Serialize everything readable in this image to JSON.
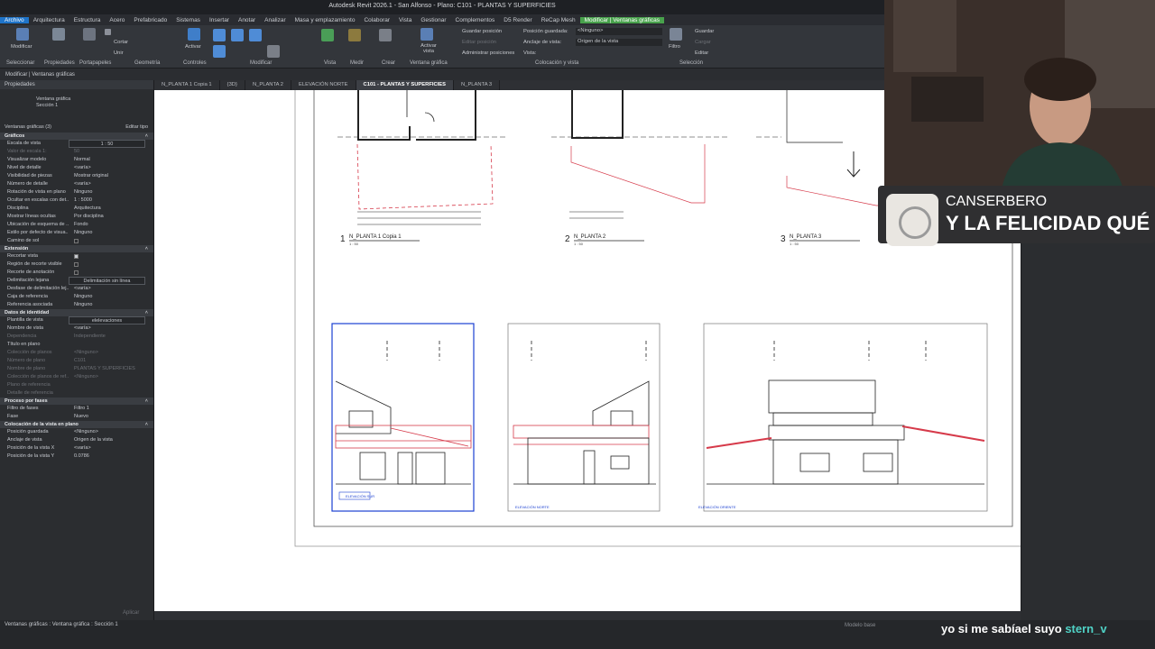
{
  "window": {
    "title": "Autodesk Revit 2026.1 - San Alfonso - Plano: C101 - PLANTAS Y SUPERFICIES"
  },
  "menu": [
    "Archivo",
    "Arquitectura",
    "Estructura",
    "Acero",
    "Prefabricado",
    "Sistemas",
    "Insertar",
    "Anotar",
    "Analizar",
    "Masa y emplazamiento",
    "Colaborar",
    "Vista",
    "Gestionar",
    "Complementos",
    "D5 Render",
    "ReCap Mesh",
    "Modificar | Ventanas gráficas"
  ],
  "ribbon": {
    "modify": "Modificar",
    "groups": [
      "Seleccionar",
      "Propiedades",
      "Portapapeles",
      "Geometría",
      "Controles",
      "Modificar",
      "Vista",
      "Medir",
      "Crear",
      "Ventana gráfica",
      "Colocación y vista",
      "Selección"
    ],
    "activate_view": "Activar vista",
    "save_position": "Guardar posición",
    "edit_position": "Editar posición",
    "manage_positions": "Administrar posiciones",
    "saved_position_label": "Posición guardada:",
    "saved_position_value": "<Ninguno>",
    "anchor_label": "Anclaje de vista:",
    "anchor_value": "Origen de la vista",
    "view_label": "Vista:",
    "filter": "Filtro",
    "save": "Guardar",
    "load": "Cargar",
    "edit": "Editar",
    "cortar": "Cortar",
    "unir": "Unir",
    "activar": "Activar"
  },
  "options_bar": "Modificar | Ventanas gráficas",
  "properties": {
    "header": "Propiedades",
    "type_line1": "Ventana gráfica",
    "type_line2": "Sección 1",
    "selector": "Ventanas gráficas (3)",
    "edit_type": "Editar tipo",
    "apply": "Aplicar",
    "sections": [
      {
        "title": "Gráficos",
        "rows": [
          {
            "k": "Escala de vista",
            "v": "1 : 50",
            "box": true
          },
          {
            "k": "Valor de escala 1:",
            "v": "50",
            "dim": true
          },
          {
            "k": "Visualizar modelo",
            "v": "Normal"
          },
          {
            "k": "Nivel de detalle",
            "v": "<varía>"
          },
          {
            "k": "Visibilidad de piezas",
            "v": "Mostrar original"
          },
          {
            "k": "Número de detalle",
            "v": "<varía>"
          },
          {
            "k": "Rotación de vista en plano",
            "v": "Ninguno"
          },
          {
            "k": "Ocultar en escalas con det...",
            "v": "1 : 5000"
          },
          {
            "k": "Disciplina",
            "v": "Arquitectura"
          },
          {
            "k": "Mostrar líneas ocultas",
            "v": "Por disciplina"
          },
          {
            "k": "Ubicación de esquema de ...",
            "v": "Fondo"
          },
          {
            "k": "Estilo por defecto de visua...",
            "v": "Ninguno"
          },
          {
            "k": "Camino de sol",
            "v": "",
            "check": false
          }
        ]
      },
      {
        "title": "Extensión",
        "rows": [
          {
            "k": "Recortar vista",
            "v": "",
            "check": true
          },
          {
            "k": "Región de recorte visible",
            "v": "",
            "check": false
          },
          {
            "k": "Recorte de anotación",
            "v": "",
            "check": false
          },
          {
            "k": "Delimitación lejana",
            "v": "Delimitación sin línea",
            "box": true
          },
          {
            "k": "Desfase de delimitación lej...",
            "v": "<varía>"
          },
          {
            "k": "Caja de referencia",
            "v": "Ninguno"
          },
          {
            "k": "Referencia asociada",
            "v": "Ninguno"
          }
        ]
      },
      {
        "title": "Datos de identidad",
        "rows": [
          {
            "k": "Plantilla de vista",
            "v": "elelevaciones",
            "box": true
          },
          {
            "k": "Nombre de vista",
            "v": "<varía>"
          },
          {
            "k": "Dependencia",
            "v": "Independiente",
            "dim": true
          },
          {
            "k": "Título en plano",
            "v": ""
          },
          {
            "k": "Colección de planos",
            "v": "<Ninguno>",
            "dim": true
          },
          {
            "k": "Número de plano",
            "v": "C101",
            "dim": true
          },
          {
            "k": "Nombre de plano",
            "v": "PLANTAS Y SUPERFICIES",
            "dim": true
          },
          {
            "k": "Colección de planos de ref...",
            "v": "<Ninguno>",
            "dim": true
          },
          {
            "k": "Plano de referencia",
            "v": "",
            "dim": true
          },
          {
            "k": "Detalle de referencia",
            "v": "",
            "dim": true
          }
        ]
      },
      {
        "title": "Proceso por fases",
        "rows": [
          {
            "k": "Filtro de fases",
            "v": "Filtro 1"
          },
          {
            "k": "Fase",
            "v": "Nuevo"
          }
        ]
      },
      {
        "title": "Colocación de la vista en plano",
        "rows": [
          {
            "k": "Posición guardada",
            "v": "<Ninguno>"
          },
          {
            "k": "Anclaje de vista",
            "v": "Origen de la vista"
          },
          {
            "k": "Posición de la vista X",
            "v": "<varía>"
          },
          {
            "k": "Posición de la vista Y",
            "v": "0.0786"
          }
        ]
      }
    ]
  },
  "tabs": [
    "N_PLANTA 1 Copia 1",
    "{3D}",
    "N_PLANTA 2",
    "ELEVACIÓN NORTE",
    "C101 - PLANTAS Y SUPERFICIES",
    "N_PLANTA 3"
  ],
  "active_tab_index": 4,
  "sheet": {
    "plan_labels": [
      {
        "num": "1",
        "name": "N_PLANTA 1 Copia 1",
        "scale": "1 : 50"
      },
      {
        "num": "2",
        "name": "N_PLANTA 2",
        "scale": "1 : 50"
      },
      {
        "num": "3",
        "name": "N_PLANTA 3",
        "scale": "1 : 50"
      }
    ],
    "elevation_tags": [
      "ELEVACIÓN SUR",
      "ELEVACIÓN NORTE",
      "ELEVACIÓN ORIENTE"
    ]
  },
  "statusbar": {
    "text": "Ventanas gráficas : Ventana gráfica : Sección 1",
    "model": "Modelo base"
  },
  "music": {
    "artist": "CANSERBERO",
    "title": "Y LA FELICIDAD QUÉ"
  },
  "chat": {
    "message": "yo si me sabíael suyo",
    "user": "stern_v"
  },
  "colors": {
    "accent": "#1f74c9",
    "context_tab": "#48a24c",
    "selected_view": "#1a3fd1",
    "red_line": "#d63a4a"
  }
}
